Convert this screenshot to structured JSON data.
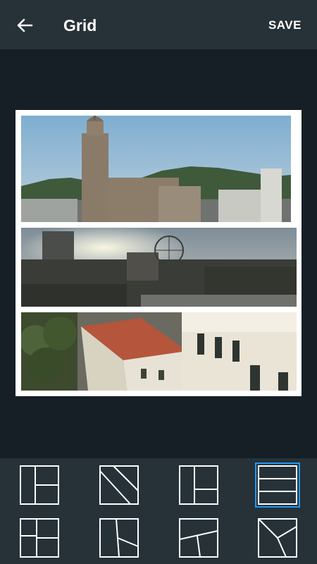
{
  "toolbar": {
    "back_icon": "arrow-left-icon",
    "title": "Grid",
    "save_label": "SAVE"
  },
  "colors": {
    "appbar": "#263238",
    "background": "#161f25",
    "frame": "#ffffff",
    "selection": "#2196f3"
  },
  "collage": {
    "layout": "three-horizontal-strips",
    "photos": [
      {
        "name": "cathedral-tower-photo"
      },
      {
        "name": "ferris-wheel-skyline-photo"
      },
      {
        "name": "red-roof-buildings-photo"
      }
    ]
  },
  "layouts": {
    "selected_index": 3,
    "options": [
      {
        "name": "layout-left-tall-right-split"
      },
      {
        "name": "layout-diagonal-split"
      },
      {
        "name": "layout-left-tall-right-split-alt"
      },
      {
        "name": "layout-three-rows"
      },
      {
        "name": "layout-four-grid-variant"
      },
      {
        "name": "layout-slanted-right-split"
      },
      {
        "name": "layout-angled-three"
      },
      {
        "name": "layout-y-split"
      }
    ]
  }
}
